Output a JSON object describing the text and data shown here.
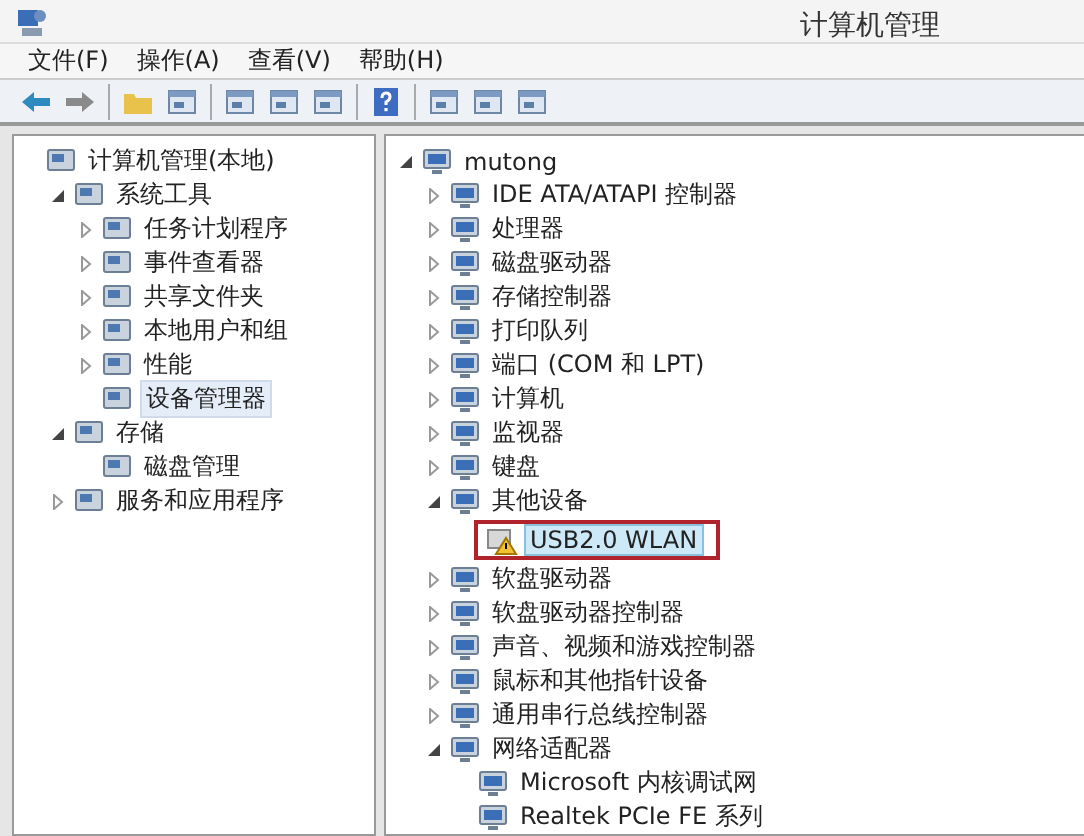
{
  "window": {
    "title": "计算机管理"
  },
  "menu": [
    "文件(F)",
    "操作(A)",
    "查看(V)",
    "帮助(H)"
  ],
  "left_tree": [
    {
      "label": "计算机管理(本地)",
      "selected": false,
      "children": [
        {
          "label": "系统工具",
          "expanded": true,
          "selected": false,
          "children": [
            {
              "label": "任务计划程序",
              "expanded": false,
              "selected": false
            },
            {
              "label": "事件查看器",
              "expanded": false,
              "selected": false
            },
            {
              "label": "共享文件夹",
              "expanded": false,
              "selected": false
            },
            {
              "label": "本地用户和组",
              "expanded": false,
              "selected": false
            },
            {
              "label": "性能",
              "expanded": false,
              "selected": false
            },
            {
              "label": "设备管理器",
              "selected": true
            }
          ]
        },
        {
          "label": "存储",
          "expanded": true,
          "selected": false,
          "children": [
            {
              "label": "磁盘管理",
              "selected": false
            }
          ]
        },
        {
          "label": "服务和应用程序",
          "expanded": false,
          "selected": false
        }
      ]
    }
  ],
  "right_tree": [
    {
      "label": "mutong",
      "expanded": true,
      "children": [
        {
          "label": "IDE ATA/ATAPI 控制器",
          "expanded": false
        },
        {
          "label": "处理器",
          "expanded": false
        },
        {
          "label": "磁盘驱动器",
          "expanded": false
        },
        {
          "label": "存储控制器",
          "expanded": false
        },
        {
          "label": "打印队列",
          "expanded": false
        },
        {
          "label": "端口 (COM 和 LPT)",
          "expanded": false
        },
        {
          "label": "计算机",
          "expanded": false
        },
        {
          "label": "监视器",
          "expanded": false
        },
        {
          "label": "键盘",
          "expanded": false
        },
        {
          "label": "其他设备",
          "expanded": true,
          "children": [
            {
              "label": "USB2.0 WLAN",
              "warning": true,
              "highlighted": true
            }
          ]
        },
        {
          "label": "软盘驱动器",
          "expanded": false
        },
        {
          "label": "软盘驱动器控制器",
          "expanded": false
        },
        {
          "label": "声音、视频和游戏控制器",
          "expanded": false
        },
        {
          "label": "鼠标和其他指针设备",
          "expanded": false
        },
        {
          "label": "通用串行总线控制器",
          "expanded": false
        },
        {
          "label": "网络适配器",
          "expanded": true,
          "children": [
            {
              "label": "Microsoft 内核调试网"
            },
            {
              "label": "Realtek PCIe FE 系列"
            }
          ]
        }
      ]
    }
  ]
}
